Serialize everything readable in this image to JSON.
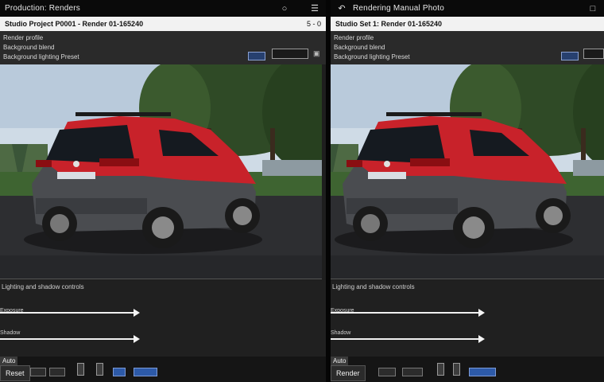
{
  "left": {
    "title": "Production: Renders",
    "info_text": "Studio Project P0001 - Render 01-165240",
    "info_right": "5 - 0",
    "meta_rows": [
      "Render profile",
      "Background blend",
      "Background lighting Preset"
    ],
    "controls_caption": "Lighting and shadow controls",
    "slider_labels": [
      "Exposure",
      "Shadow"
    ],
    "bottom_small": "Auto",
    "bottom_button": "Reset"
  },
  "right": {
    "title": "Rendering Manual Photo",
    "info_text": "Studio Set 1: Render 01-165240",
    "meta_rows": [
      "Render profile",
      "Background blend",
      "Background lighting Preset"
    ],
    "controls_caption": "Lighting and shadow controls",
    "slider_labels": [
      "Exposure",
      "Shadow"
    ],
    "bottom_small": "Auto",
    "bottom_button": "Render"
  },
  "colors": {
    "accent_blue": "#2d5aa8",
    "car_red": "#c8222a",
    "car_grey": "#4a4c50"
  },
  "icons": [
    "menu-icon",
    "search-icon",
    "back-icon",
    "document-icon"
  ]
}
